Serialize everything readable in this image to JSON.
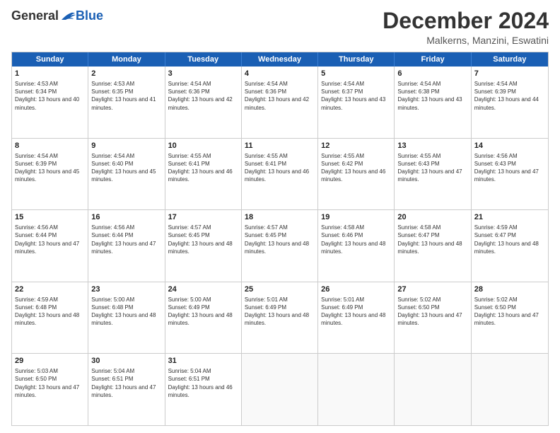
{
  "logo": {
    "general": "General",
    "blue": "Blue"
  },
  "header": {
    "month": "December 2024",
    "location": "Malkerns, Manzini, Eswatini"
  },
  "days": [
    "Sunday",
    "Monday",
    "Tuesday",
    "Wednesday",
    "Thursday",
    "Friday",
    "Saturday"
  ],
  "weeks": [
    [
      {
        "day": 1,
        "sunrise": "Sunrise: 4:53 AM",
        "sunset": "Sunset: 6:34 PM",
        "daylight": "Daylight: 13 hours and 40 minutes."
      },
      {
        "day": 2,
        "sunrise": "Sunrise: 4:53 AM",
        "sunset": "Sunset: 6:35 PM",
        "daylight": "Daylight: 13 hours and 41 minutes."
      },
      {
        "day": 3,
        "sunrise": "Sunrise: 4:54 AM",
        "sunset": "Sunset: 6:36 PM",
        "daylight": "Daylight: 13 hours and 42 minutes."
      },
      {
        "day": 4,
        "sunrise": "Sunrise: 4:54 AM",
        "sunset": "Sunset: 6:36 PM",
        "daylight": "Daylight: 13 hours and 42 minutes."
      },
      {
        "day": 5,
        "sunrise": "Sunrise: 4:54 AM",
        "sunset": "Sunset: 6:37 PM",
        "daylight": "Daylight: 13 hours and 43 minutes."
      },
      {
        "day": 6,
        "sunrise": "Sunrise: 4:54 AM",
        "sunset": "Sunset: 6:38 PM",
        "daylight": "Daylight: 13 hours and 43 minutes."
      },
      {
        "day": 7,
        "sunrise": "Sunrise: 4:54 AM",
        "sunset": "Sunset: 6:39 PM",
        "daylight": "Daylight: 13 hours and 44 minutes."
      }
    ],
    [
      {
        "day": 8,
        "sunrise": "Sunrise: 4:54 AM",
        "sunset": "Sunset: 6:39 PM",
        "daylight": "Daylight: 13 hours and 45 minutes."
      },
      {
        "day": 9,
        "sunrise": "Sunrise: 4:54 AM",
        "sunset": "Sunset: 6:40 PM",
        "daylight": "Daylight: 13 hours and 45 minutes."
      },
      {
        "day": 10,
        "sunrise": "Sunrise: 4:55 AM",
        "sunset": "Sunset: 6:41 PM",
        "daylight": "Daylight: 13 hours and 46 minutes."
      },
      {
        "day": 11,
        "sunrise": "Sunrise: 4:55 AM",
        "sunset": "Sunset: 6:41 PM",
        "daylight": "Daylight: 13 hours and 46 minutes."
      },
      {
        "day": 12,
        "sunrise": "Sunrise: 4:55 AM",
        "sunset": "Sunset: 6:42 PM",
        "daylight": "Daylight: 13 hours and 46 minutes."
      },
      {
        "day": 13,
        "sunrise": "Sunrise: 4:55 AM",
        "sunset": "Sunset: 6:43 PM",
        "daylight": "Daylight: 13 hours and 47 minutes."
      },
      {
        "day": 14,
        "sunrise": "Sunrise: 4:56 AM",
        "sunset": "Sunset: 6:43 PM",
        "daylight": "Daylight: 13 hours and 47 minutes."
      }
    ],
    [
      {
        "day": 15,
        "sunrise": "Sunrise: 4:56 AM",
        "sunset": "Sunset: 6:44 PM",
        "daylight": "Daylight: 13 hours and 47 minutes."
      },
      {
        "day": 16,
        "sunrise": "Sunrise: 4:56 AM",
        "sunset": "Sunset: 6:44 PM",
        "daylight": "Daylight: 13 hours and 47 minutes."
      },
      {
        "day": 17,
        "sunrise": "Sunrise: 4:57 AM",
        "sunset": "Sunset: 6:45 PM",
        "daylight": "Daylight: 13 hours and 48 minutes."
      },
      {
        "day": 18,
        "sunrise": "Sunrise: 4:57 AM",
        "sunset": "Sunset: 6:45 PM",
        "daylight": "Daylight: 13 hours and 48 minutes."
      },
      {
        "day": 19,
        "sunrise": "Sunrise: 4:58 AM",
        "sunset": "Sunset: 6:46 PM",
        "daylight": "Daylight: 13 hours and 48 minutes."
      },
      {
        "day": 20,
        "sunrise": "Sunrise: 4:58 AM",
        "sunset": "Sunset: 6:47 PM",
        "daylight": "Daylight: 13 hours and 48 minutes."
      },
      {
        "day": 21,
        "sunrise": "Sunrise: 4:59 AM",
        "sunset": "Sunset: 6:47 PM",
        "daylight": "Daylight: 13 hours and 48 minutes."
      }
    ],
    [
      {
        "day": 22,
        "sunrise": "Sunrise: 4:59 AM",
        "sunset": "Sunset: 6:48 PM",
        "daylight": "Daylight: 13 hours and 48 minutes."
      },
      {
        "day": 23,
        "sunrise": "Sunrise: 5:00 AM",
        "sunset": "Sunset: 6:48 PM",
        "daylight": "Daylight: 13 hours and 48 minutes."
      },
      {
        "day": 24,
        "sunrise": "Sunrise: 5:00 AM",
        "sunset": "Sunset: 6:49 PM",
        "daylight": "Daylight: 13 hours and 48 minutes."
      },
      {
        "day": 25,
        "sunrise": "Sunrise: 5:01 AM",
        "sunset": "Sunset: 6:49 PM",
        "daylight": "Daylight: 13 hours and 48 minutes."
      },
      {
        "day": 26,
        "sunrise": "Sunrise: 5:01 AM",
        "sunset": "Sunset: 6:49 PM",
        "daylight": "Daylight: 13 hours and 48 minutes."
      },
      {
        "day": 27,
        "sunrise": "Sunrise: 5:02 AM",
        "sunset": "Sunset: 6:50 PM",
        "daylight": "Daylight: 13 hours and 47 minutes."
      },
      {
        "day": 28,
        "sunrise": "Sunrise: 5:02 AM",
        "sunset": "Sunset: 6:50 PM",
        "daylight": "Daylight: 13 hours and 47 minutes."
      }
    ],
    [
      {
        "day": 29,
        "sunrise": "Sunrise: 5:03 AM",
        "sunset": "Sunset: 6:50 PM",
        "daylight": "Daylight: 13 hours and 47 minutes."
      },
      {
        "day": 30,
        "sunrise": "Sunrise: 5:04 AM",
        "sunset": "Sunset: 6:51 PM",
        "daylight": "Daylight: 13 hours and 47 minutes."
      },
      {
        "day": 31,
        "sunrise": "Sunrise: 5:04 AM",
        "sunset": "Sunset: 6:51 PM",
        "daylight": "Daylight: 13 hours and 46 minutes."
      },
      null,
      null,
      null,
      null
    ]
  ]
}
